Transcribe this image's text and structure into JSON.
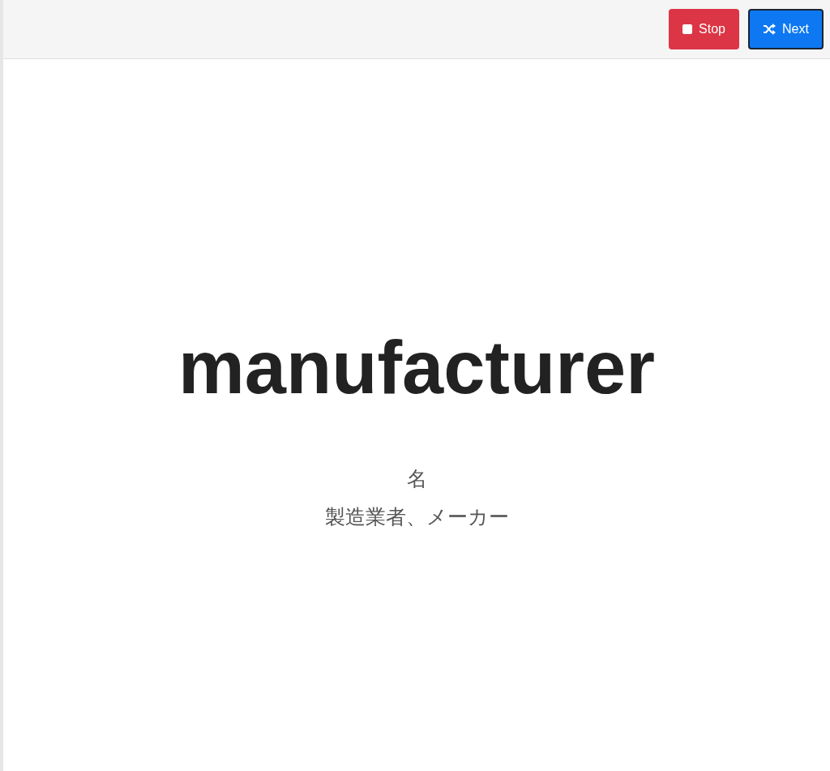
{
  "toolbar": {
    "buttons": [
      {
        "kind": "stop",
        "label": "Stop",
        "focused": false
      },
      {
        "kind": "next",
        "label": "Next",
        "focused": true
      }
    ]
  },
  "card": {
    "word": "manufacturer",
    "part_of_speech": "名",
    "meaning": "製造業者、メーカー"
  }
}
